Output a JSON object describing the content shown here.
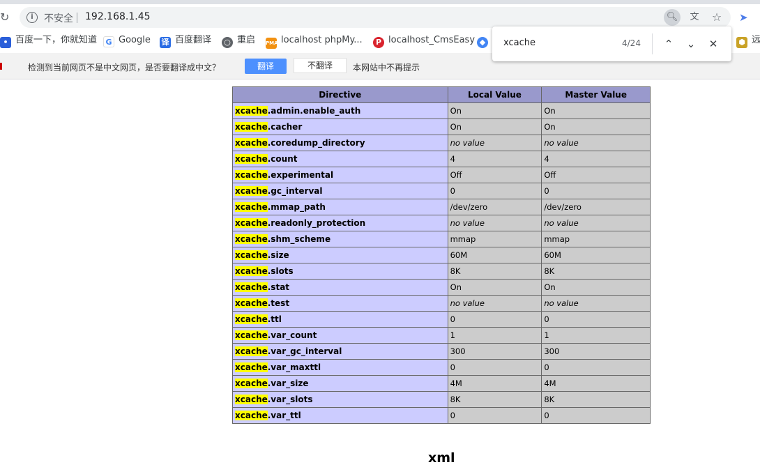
{
  "browser": {
    "security_label": "不安全",
    "url": "192.168.1.45"
  },
  "bookmarks": [
    {
      "label": "百度一下，你就知道",
      "icon": "baidu-paw-icon"
    },
    {
      "label": "Google",
      "icon": "google-icon"
    },
    {
      "label": "百度翻译",
      "icon": "baidu-translate-icon"
    },
    {
      "label": "重启",
      "icon": "globe-icon"
    },
    {
      "label": "localhost phpMy...",
      "icon": "phpmyadmin-icon"
    },
    {
      "label": "localhost_CmsEasy",
      "icon": "cmseasy-icon"
    },
    {
      "label": "远",
      "icon": "extension-icon"
    }
  ],
  "translate_bar": {
    "message": "检测到当前网页不是中文网页，是否要翻译成中文？",
    "translate_label": "翻译",
    "no_translate_label": "不翻译",
    "never_label": "本网站中不再提示"
  },
  "find_bar": {
    "query": "xcache",
    "count": "4/24"
  },
  "table": {
    "headers": [
      "Directive",
      "Local Value",
      "Master Value"
    ],
    "prefix": "xcache",
    "rows": [
      {
        "suffix": ".admin.enable_auth",
        "local": "On",
        "master": "On"
      },
      {
        "suffix": ".cacher",
        "local": "On",
        "master": "On"
      },
      {
        "suffix": ".coredump_directory",
        "local": "no value",
        "master": "no value"
      },
      {
        "suffix": ".count",
        "local": "4",
        "master": "4"
      },
      {
        "suffix": ".experimental",
        "local": "Off",
        "master": "Off"
      },
      {
        "suffix": ".gc_interval",
        "local": "0",
        "master": "0"
      },
      {
        "suffix": ".mmap_path",
        "local": "/dev/zero",
        "master": "/dev/zero"
      },
      {
        "suffix": ".readonly_protection",
        "local": "no value",
        "master": "no value"
      },
      {
        "suffix": ".shm_scheme",
        "local": "mmap",
        "master": "mmap"
      },
      {
        "suffix": ".size",
        "local": "60M",
        "master": "60M"
      },
      {
        "suffix": ".slots",
        "local": "8K",
        "master": "8K"
      },
      {
        "suffix": ".stat",
        "local": "On",
        "master": "On"
      },
      {
        "suffix": ".test",
        "local": "no value",
        "master": "no value"
      },
      {
        "suffix": ".ttl",
        "local": "0",
        "master": "0"
      },
      {
        "suffix": ".var_count",
        "local": "1",
        "master": "1"
      },
      {
        "suffix": ".var_gc_interval",
        "local": "300",
        "master": "300"
      },
      {
        "suffix": ".var_maxttl",
        "local": "0",
        "master": "0"
      },
      {
        "suffix": ".var_size",
        "local": "4M",
        "master": "4M"
      },
      {
        "suffix": ".var_slots",
        "local": "8K",
        "master": "8K"
      },
      {
        "suffix": ".var_ttl",
        "local": "0",
        "master": "0"
      }
    ]
  },
  "next_section_title": "xml"
}
